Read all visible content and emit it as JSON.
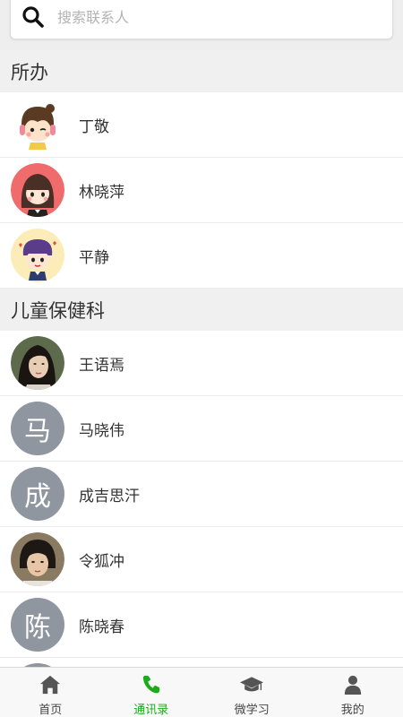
{
  "search": {
    "placeholder": "搜索联系人"
  },
  "groups": [
    {
      "name": "所办",
      "contacts": [
        {
          "name": "丁敬",
          "avatar_icon": "cartoon-girl-headphones-avatar"
        },
        {
          "name": "林晓萍",
          "avatar_icon": "cartoon-girl-avatar"
        },
        {
          "name": "平静",
          "avatar_icon": "cartoon-boy-avatar"
        }
      ]
    },
    {
      "name": "儿童保健科",
      "contacts": [
        {
          "name": "王语焉",
          "avatar_icon": "photo-avatar"
        },
        {
          "name": "马晓伟",
          "avatar_text": "马"
        },
        {
          "name": "成吉思汗",
          "avatar_text": "成"
        },
        {
          "name": "令狐冲",
          "avatar_icon": "photo-avatar"
        },
        {
          "name": "陈晓春",
          "avatar_text": "陈"
        }
      ]
    }
  ],
  "tabs": [
    {
      "label": "首页",
      "icon": "home-icon",
      "active": false
    },
    {
      "label": "通讯录",
      "icon": "phone-icon",
      "active": true
    },
    {
      "label": "微学习",
      "icon": "graduation-cap-icon",
      "active": false
    },
    {
      "label": "我的",
      "icon": "user-icon",
      "active": false
    }
  ],
  "colors": {
    "active_tab": "#1aad19",
    "text_avatar_bg": "#8f96a0",
    "header_bg": "#f0f0f0"
  }
}
